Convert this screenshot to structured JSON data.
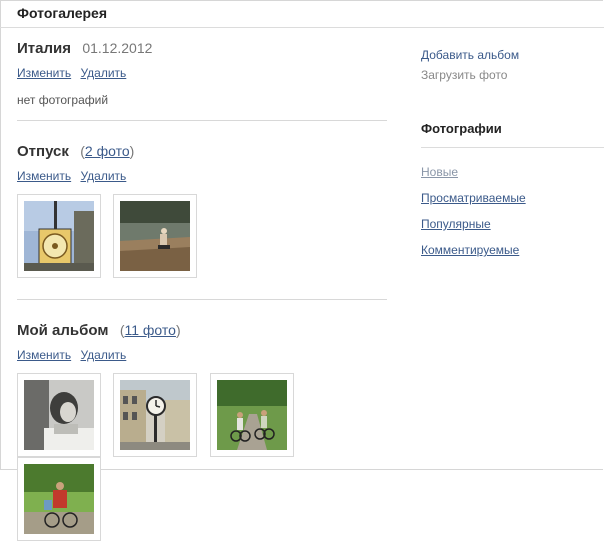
{
  "page": {
    "title": "Фотогалерея"
  },
  "albums": [
    {
      "name": "Италия",
      "date": "01.12.2012",
      "count_text": "",
      "count_open": "",
      "count_close": "",
      "edit": "Изменить",
      "delete": "Удалить",
      "empty_text": "нет фотографий"
    },
    {
      "name": "Отпуск",
      "count_open": "(",
      "count_text": "2 фото",
      "count_close": ")",
      "edit": "Изменить",
      "delete": "Удалить"
    },
    {
      "name": "Мой альбом",
      "count_open": "(",
      "count_text": "11 фото",
      "count_close": ")",
      "edit": "Изменить",
      "delete": "Удалить"
    }
  ],
  "sidebar": {
    "add_album": "Добавить альбом",
    "upload_photo": "Загрузить фото",
    "photos_heading": "Фотографии",
    "photo_links": [
      "Новые",
      "Просматриваемые",
      "Популярные",
      "Комментируемые"
    ]
  },
  "colors": {
    "link": "#3b5a8a",
    "muted": "#888888"
  }
}
